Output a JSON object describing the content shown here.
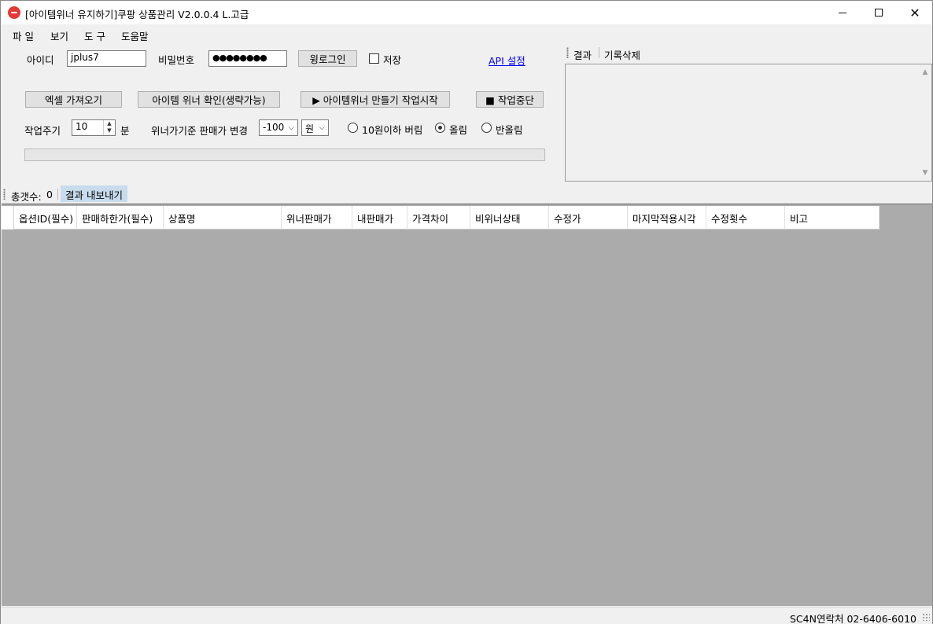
{
  "window": {
    "title": "[아이템위너 유지하기]쿠팡 상품관리 V2.0.0.4 L.고급"
  },
  "menu": {
    "items": [
      "파 일",
      "보기",
      "도 구",
      "도움말"
    ]
  },
  "login": {
    "id_label": "아이디",
    "id_value": "jplus7",
    "password_label": "비밀번호",
    "password_mask": "●●●●●●●●",
    "login_button": "윙로그인",
    "save_label": "저장",
    "api_link": "API 설정"
  },
  "actions": {
    "excel_import": "엑셀 가져오기",
    "winner_check": "아이템 위너 확인(생략가능)",
    "start": "▶ 아이템위너 만들기 작업시작",
    "stop": "■ 작업중단"
  },
  "settings": {
    "cycle_label": "작업주기",
    "cycle_value": "10",
    "cycle_unit": "분",
    "price_change_label": "위너가기준 판매가 변경",
    "price_change_value": "-100",
    "currency_value": "원",
    "rounding_options": [
      {
        "label": "10원이하 버림",
        "checked": false
      },
      {
        "label": "올림",
        "checked": true
      },
      {
        "label": "반올림",
        "checked": false
      }
    ]
  },
  "result_panel": {
    "tab_result": "결과",
    "tab_clear": "기록삭제"
  },
  "summary": {
    "total_label": "총갯수:",
    "total_value": "0",
    "export_button": "결과 내보내기"
  },
  "grid": {
    "columns": [
      "옵션ID(필수)",
      "판매하한가(필수)",
      "상품명",
      "위너판매가",
      "내판매가",
      "가격차이",
      "비위너상태",
      "수정가",
      "마지막적용시각",
      "수정횟수",
      "비고"
    ]
  },
  "status": {
    "contact": "SC4N연락처 02-6406-6010"
  }
}
